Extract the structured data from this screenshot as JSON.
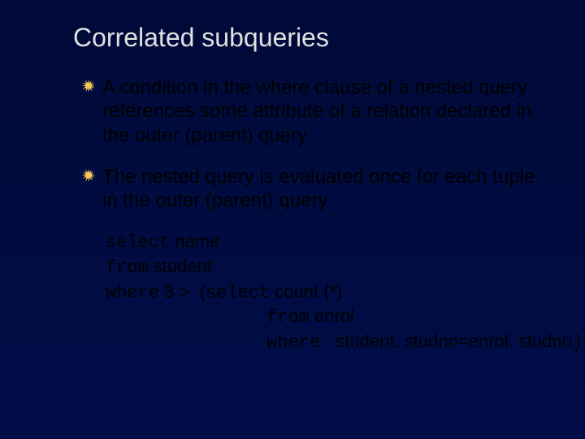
{
  "title": "Correlated subqueries",
  "bullets": [
    {
      "text": "A condition in the where clause of a nested query references some attribute of a relation declared in the outer (parent) query"
    },
    {
      "text": "The nested query is evaluated once for each tuple in the outer (parent) query"
    }
  ],
  "code": {
    "l1_kw": "select",
    "l1_rest": " name",
    "l2_kw": "from",
    "l2_rest": " student",
    "l3_kw": "where",
    "l3_mid": " 3 >  (",
    "l3_kw2": "select",
    "l3_rest": " count (*)",
    "l4_pad": "               ",
    "l4_kw": "from",
    "l4_rest": " enrol",
    "l5_pad": "               ",
    "l5_kw": "where ",
    "l5_rest": " student. studno=enrol. studno",
    "l5_close": ")"
  },
  "bullet_color": "#f7c95a"
}
